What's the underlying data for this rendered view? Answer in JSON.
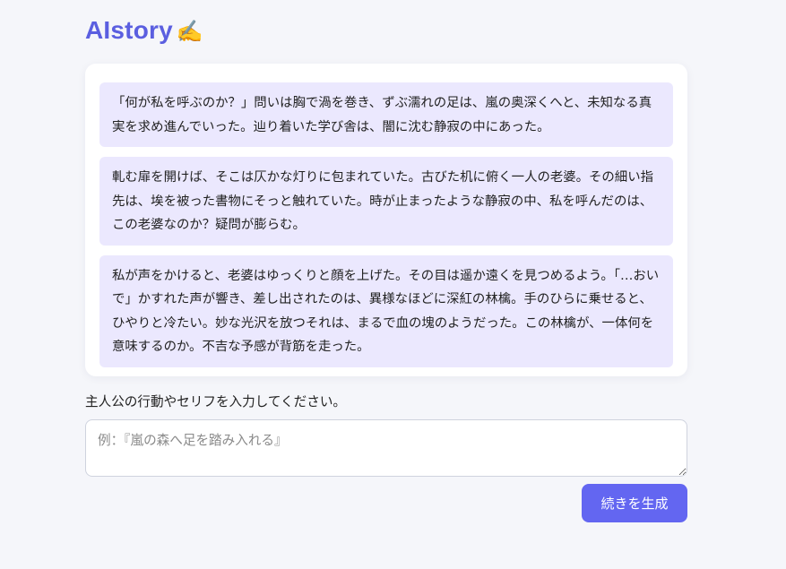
{
  "app": {
    "title": "AIstory",
    "title_emoji": "✍️"
  },
  "story": {
    "paragraphs": [
      "「何が私を呼ぶのか？」問いは胸で渦を巻き、ずぶ濡れの足は、嵐の奥深くへと、未知なる真実を求め進んでいった。辿り着いた学び舎は、闇に沈む静寂の中にあった。",
      "軋む扉を開けば、そこは仄かな灯りに包まれていた。古びた机に俯く一人の老婆。その細い指先は、埃を被った書物にそっと触れていた。時が止まったような静寂の中、私を呼んだのは、この老婆なのか？疑問が膨らむ。",
      "私が声をかけると、老婆はゆっくりと顔を上げた。その目は遥か遠くを見つめるよう。「…おいで」かすれた声が響き、差し出されたのは、異様なほどに深紅の林檎。手のひらに乗せると、ひやりと冷たい。妙な光沢を放つそれは、まるで血の塊のようだった。この林檎が、一体何を意味するのか。不吉な予感が背筋を走った。"
    ]
  },
  "prompt": {
    "label": "主人公の行動やセリフを入力してください。",
    "value": "",
    "placeholder": "例：『嵐の森へ足を踏み入れる』"
  },
  "actions": {
    "generate_label": "続きを生成"
  },
  "colors": {
    "accent": "#6366f1",
    "title": "#5b5fe0",
    "paragraph_bg": "#ebe8fe",
    "page_bg": "#f5f6fa"
  }
}
